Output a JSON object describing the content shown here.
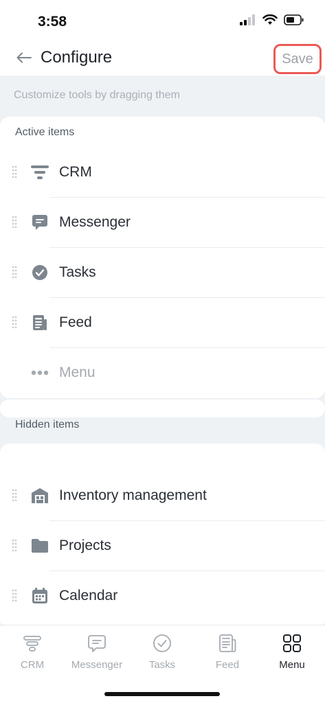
{
  "status_bar": {
    "time": "3:58"
  },
  "nav": {
    "title": "Configure",
    "save_label": "Save"
  },
  "hint": "Customize tools by dragging them",
  "active_section": {
    "label": "Active items",
    "items": [
      {
        "label": "CRM",
        "icon": "funnel-icon"
      },
      {
        "label": "Messenger",
        "icon": "chat-bubble-icon"
      },
      {
        "label": "Tasks",
        "icon": "check-circle-icon"
      },
      {
        "label": "Feed",
        "icon": "newspaper-icon"
      },
      {
        "label": "Menu",
        "icon": "more-dots-icon"
      }
    ]
  },
  "hidden_section": {
    "label": "Hidden items",
    "items": [
      {
        "label": "Inventory management",
        "icon": "warehouse-icon"
      },
      {
        "label": "Projects",
        "icon": "folder-icon"
      },
      {
        "label": "Calendar",
        "icon": "calendar-icon"
      }
    ]
  },
  "tabbar": {
    "tabs": [
      {
        "label": "CRM",
        "icon": "funnel-icon"
      },
      {
        "label": "Messenger",
        "icon": "chat-bubble-icon"
      },
      {
        "label": "Tasks",
        "icon": "check-circle-icon"
      },
      {
        "label": "Feed",
        "icon": "newspaper-icon"
      },
      {
        "label": "Menu",
        "icon": "grid-icon",
        "selected": true
      }
    ]
  },
  "colors": {
    "save_highlight": "#ea5a55",
    "icon_gray": "#7d868e",
    "muted_text": "#a4aab0",
    "background": "#eef2f5"
  }
}
